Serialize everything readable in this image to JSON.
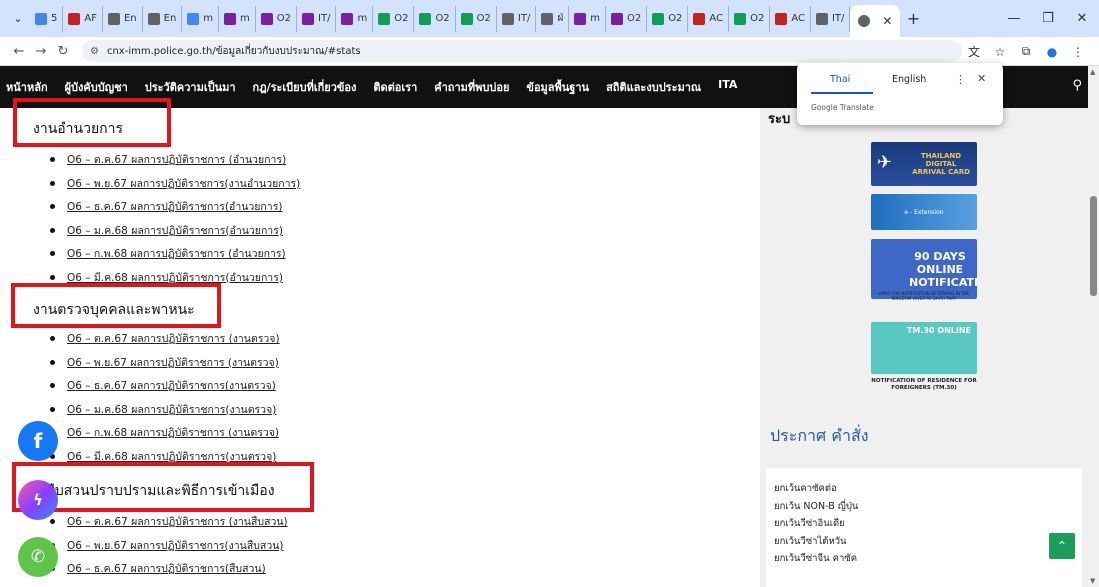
{
  "browser": {
    "tabs": [
      {
        "label": "5",
        "color": "#4285f4"
      },
      {
        "label": "AF",
        "color": "#c5221f"
      },
      {
        "label": "En",
        "color": "#5f6368"
      },
      {
        "label": "En",
        "color": "#5f6368"
      },
      {
        "label": "m",
        "color": "#4285f4"
      },
      {
        "label": "m",
        "color": "#7b1fa2"
      },
      {
        "label": "O2",
        "color": "#7b1fa2"
      },
      {
        "label": "IT/",
        "color": "#7b1fa2"
      },
      {
        "label": "m",
        "color": "#7b1fa2"
      },
      {
        "label": "O2",
        "color": "#0f9d58"
      },
      {
        "label": "O2",
        "color": "#0f9d58"
      },
      {
        "label": "O2",
        "color": "#0f9d58"
      },
      {
        "label": "IT/",
        "color": "#5f6368"
      },
      {
        "label": "ฝ่",
        "color": "#5f6368"
      },
      {
        "label": "m",
        "color": "#7b1fa2"
      },
      {
        "label": "O2",
        "color": "#7b1fa2"
      },
      {
        "label": "O2",
        "color": "#0f9d58"
      },
      {
        "label": "AC",
        "color": "#c5221f"
      },
      {
        "label": "O2",
        "color": "#0f9d58"
      },
      {
        "label": "AC",
        "color": "#c5221f"
      },
      {
        "label": "IT/",
        "color": "#5f6368"
      }
    ],
    "new_tab": "+",
    "url": "cnx-imm.police.go.th/ข้อมูลเกี่ยวกับงบประมาณ/#stats"
  },
  "menu": {
    "items": [
      "หน้าหลัก",
      "ผู้บังคับบัญชา",
      "ประวัติความเป็นมา",
      "กฎ/ระเบียบที่เกี่ยวข้อง",
      "ติดต่อเรา",
      "คำถามที่พบบ่อย",
      "ข้อมูลพื้นฐาน",
      "สถิติและงบประมาณ",
      "ITA"
    ]
  },
  "sections": [
    {
      "title": "งานอำนวยการ",
      "items": [
        "O6 – ต.ค.67 ผลการปฏิบัติราชการ (อำนวยการ)",
        "O6 – พ.ย.67 ผลการปฏิบัติราชการ(งานอำนวยการ)",
        "O6 – ธ.ค.67 ผลการปฏิบัติราชการ(อำนวยการ)",
        "O6 – ม.ค.68 ผลการปฏิบัติราชการ(อำนวยการ)",
        "O6 – ก.พ.68 ผลการปฏิบัติราชการ (อำนวยการ)",
        "O6 – มี.ค.68 ผลการปฏิบัติราชการ(อำนวยการ)"
      ]
    },
    {
      "title": "งานตรวจบุคคลและพาหนะ",
      "items": [
        "O6 – ต.ค.67 ผลการปฏิบัติราชการ (งานตรวจ)",
        "O6 – พ.ย.67 ผลการปฏิบัติราชการ (งานตรวจ)",
        "O6 – ธ.ค.67 ผลการปฏิบัติราชการ(งานตรวจ)",
        "O6 – ม.ค.68 ผลการปฏิบัติราชการ(งานตรวจ)",
        "O6 – ก.พ.68 ผลการปฏิบัติราชการ (งานตรวจ)",
        "O6 – มี.ค.68 ผลการปฏิบัติราชการ(งานตรวจ)"
      ]
    },
    {
      "title": "งานสืบสวนปราบปรามและพิธีการเข้าเมือง",
      "items": [
        "O6 – ต.ค.67 ผลการปฏิบัติราชการ (งานสืบสวน)",
        "O6 – พ.ย.67 ผลการปฏิบัติราชการ(งานสืบสวน)",
        "O6 – ธ.ค.67 ผลการปฏิบัติราชการ(สืบสวน)"
      ]
    }
  ],
  "sidebar": {
    "heading": "ระบ",
    "banners": {
      "tdac": "THAILAND DIGITAL ARRIVAL CARD",
      "extension": "e - Extension",
      "ninety_days": "90 DAYS ONLINE NOTIFICATION",
      "ninety_caption": "APPLY FOR NOTIFICATION OF STAYING IN THE KINGDOM (OVER 90 DAYS) THAT",
      "tm30": "TM.30 ONLINE",
      "tm30_caption": "NOTIFICATION OF RESIDENCE FOR FOREIGNERS (TM.30)"
    },
    "announce_title": "ประกาศ คำสั่ง",
    "announcements": [
      "ยกเว้นคาซัคต่อ",
      "ยกเว้น NON-B ญี่ปุ่น",
      "ยกเว้นวีซ่าอินเดีย",
      "ยกเว้นวีซ่าไต้หวัน",
      "ยกเว้นวีซ่าจีน คาซัค"
    ]
  },
  "translate": {
    "thai": "Thai",
    "english": "English",
    "brand": "Google Translate"
  }
}
